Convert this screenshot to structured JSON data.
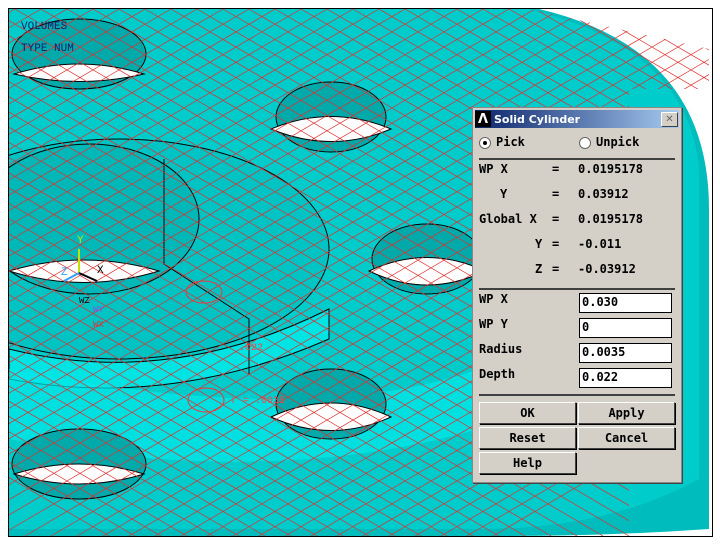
{
  "graphics": {
    "labels": [
      "VOLUMES",
      "TYPE NUM"
    ],
    "triad": {
      "x": "X",
      "y": "Y",
      "z": "Z"
    },
    "wp_triad": {
      "wz": "WZ",
      "wy": "WY",
      "wx": "WX"
    },
    "depth_annotation": ".022",
    "radius_annotation": "r = .0035",
    "colors": {
      "solid": "#00cccc",
      "grid": "#e03030",
      "hole": "#ffffff"
    }
  },
  "dialog": {
    "title": "Solid Cylinder",
    "pick": "Pick",
    "unpick": "Unpick",
    "readout": [
      {
        "label": "WP X",
        "eq": "=",
        "value": "0.0195178"
      },
      {
        "label": "Y",
        "eq": "=",
        "value": "0.03912"
      },
      {
        "label": "Global X",
        "eq": "=",
        "value": "0.0195178"
      },
      {
        "label": "Y",
        "eq": "=",
        "value": "-0.011"
      },
      {
        "label": "Z",
        "eq": "=",
        "value": "-0.03912"
      }
    ],
    "fields": [
      {
        "label": "WP X",
        "value": "0.030"
      },
      {
        "label": "WP Y",
        "value": "0"
      },
      {
        "label": "Radius",
        "value": "0.0035"
      },
      {
        "label": "Depth",
        "value": "0.022"
      }
    ],
    "buttons": {
      "ok": "OK",
      "apply": "Apply",
      "reset": "Reset",
      "cancel": "Cancel",
      "help": "Help"
    }
  }
}
